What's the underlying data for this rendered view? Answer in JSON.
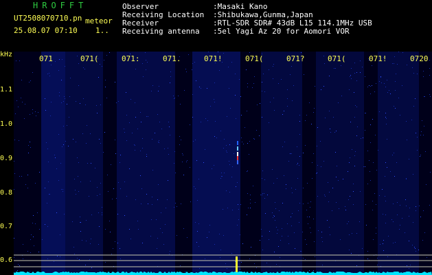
{
  "header": {
    "app_title": "HROFFT",
    "file_name": "UT2508070710.pn",
    "meteor_label": "meteor",
    "datetime": "25.08.07 07:10",
    "count": "1..",
    "info": [
      {
        "key": "Observer",
        "value": ":Masaki Kano"
      },
      {
        "key": "Receiving Location",
        "value": ":Shibukawa,Gunma,Japan"
      },
      {
        "key": "Receiver",
        "value": ":RTL-SDR SDR# 43dB L15 114.1MHz USB"
      },
      {
        "key": "Receiving antenna",
        "value": ":5el Yagi Az 20 for Aomori VOR"
      }
    ]
  },
  "spectrogram": {
    "y_unit": "kHz",
    "y_ticks": [
      "1.1",
      "1.0",
      "0.9",
      "0.8",
      "0.7",
      "0.6"
    ],
    "x_ticks": [
      "071",
      "071(",
      "071:",
      "071.",
      "071!",
      "071(",
      "071?",
      "071(",
      "071!",
      "0720"
    ],
    "colors": {
      "background": "#00001a",
      "noise": "#0a1a8a",
      "signal": "#ffff33",
      "baseline": "#00e5ff"
    }
  }
}
